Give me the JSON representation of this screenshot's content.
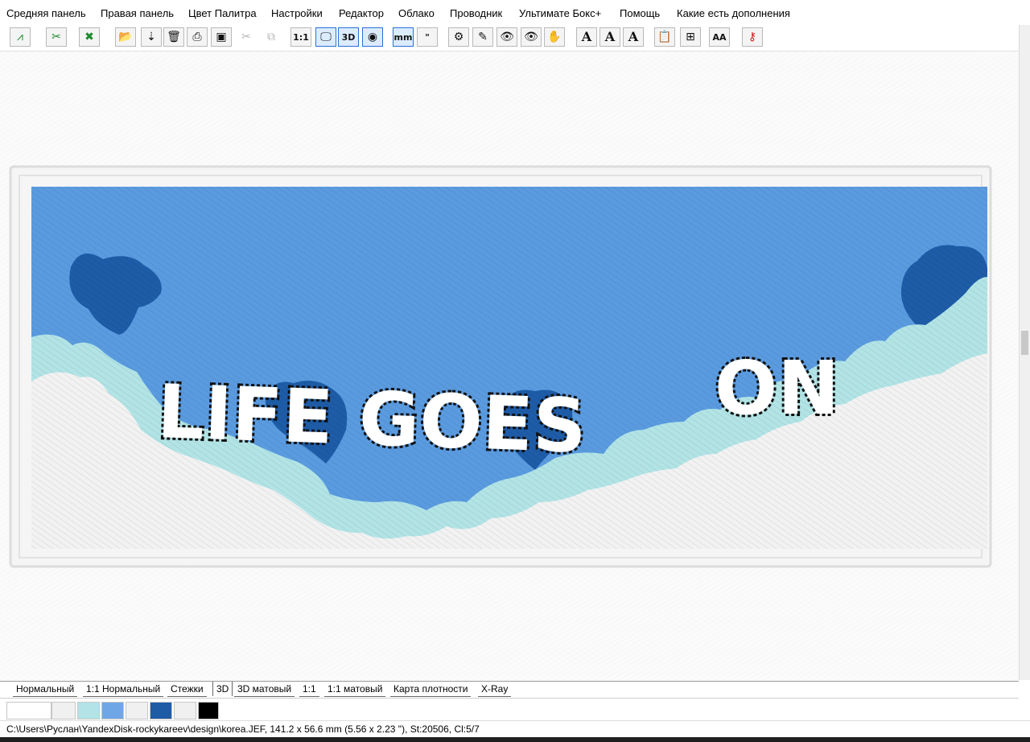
{
  "menu": [
    "Средняя панель",
    "Правая панель",
    "Цвет Палитра",
    "Настройки",
    "Редактор",
    "Облако",
    "Проводник",
    "Ультимате Бокс+",
    "Помощь",
    "Какие есть дополнения"
  ],
  "toolbar": [
    {
      "name": "satin-tool-icon",
      "glyph": "⩘",
      "active": false
    },
    {
      "name": "cut-stitches-icon",
      "glyph": "✂",
      "active": false
    },
    {
      "name": "delete-stitches-icon",
      "glyph": "✖",
      "active": false
    },
    {
      "name": "open-folder-icon",
      "glyph": "📂",
      "active": false
    },
    {
      "name": "import-icon",
      "glyph": "⇣",
      "active": false
    },
    {
      "name": "trash-icon",
      "glyph": "🗑",
      "active": false
    },
    {
      "name": "print-icon",
      "glyph": "⎙",
      "active": false
    },
    {
      "name": "save-icon",
      "glyph": "▣",
      "active": false
    },
    {
      "name": "scissors-icon",
      "glyph": "✂",
      "active": false,
      "disabled": true
    },
    {
      "name": "copy-icon",
      "glyph": "⧉",
      "active": false,
      "disabled": true
    },
    {
      "name": "actual-size-icon",
      "glyph": "1:1",
      "active": false,
      "text": true
    },
    {
      "name": "monitor-view-icon",
      "glyph": "🖵",
      "active": true
    },
    {
      "name": "3d-view-icon",
      "glyph": "3D",
      "active": true,
      "text": true
    },
    {
      "name": "realistic-view-icon",
      "glyph": "◉",
      "active": true
    },
    {
      "name": "millimeter-ruler-icon",
      "glyph": "mm",
      "active": true,
      "text": true
    },
    {
      "name": "inch-ruler-icon",
      "glyph": "\"",
      "active": false,
      "text": true
    },
    {
      "name": "machine-icon",
      "glyph": "⚙",
      "active": false
    },
    {
      "name": "needle-icon",
      "glyph": "✎",
      "active": false
    },
    {
      "name": "eye-tool-icon",
      "glyph": "👁",
      "active": false
    },
    {
      "name": "eye-measure-icon",
      "glyph": "👁",
      "active": false
    },
    {
      "name": "hand-icon",
      "glyph": "✋",
      "active": false
    },
    {
      "name": "text-icon",
      "glyph": "A",
      "active": false,
      "serif": true
    },
    {
      "name": "text-edit-icon",
      "glyph": "A",
      "active": false,
      "serif": true
    },
    {
      "name": "text-outline-icon",
      "glyph": "A",
      "active": false,
      "serif": true
    },
    {
      "name": "clipboard-icon",
      "glyph": "📋",
      "active": false
    },
    {
      "name": "tree-view-icon",
      "glyph": "⊞",
      "active": false
    },
    {
      "name": "font-size-icon",
      "glyph": "AA",
      "active": false,
      "text": true
    },
    {
      "name": "key-icon",
      "glyph": "⚷",
      "active": false
    }
  ],
  "design": {
    "text_main": "LIFE GOES",
    "text_on": "ON",
    "colors": {
      "sky": "#5a9be0",
      "sky_light": "#7fb2ea",
      "aqua": "#b2e4e6",
      "cloud": "#f2f2f2",
      "heart": "#1e5ca8",
      "outline": "#111111",
      "border": "#ededed"
    }
  },
  "tabs": [
    "Нормальный",
    "1:1 Нормальный",
    "Стежки",
    "3D",
    "3D матовый",
    "1:1",
    "1:1 матовый",
    "Карта плотности",
    "X-Ray"
  ],
  "selected_tab": "3D",
  "palette": [
    "#ffffff",
    "#f0f0f0",
    "#b3e3e6",
    "#6fa7e6",
    "#f0f0f0",
    "#1f5ca6",
    "#f0f0f0",
    "#000000"
  ],
  "status": {
    "text": "C:\\Users\\Руслан\\YandexDisk-rockykareev\\design\\korea.JEF, 141.2 x 56.6 mm (5.56 x 2.23 \"), St:20506, Cl:5/7"
  }
}
